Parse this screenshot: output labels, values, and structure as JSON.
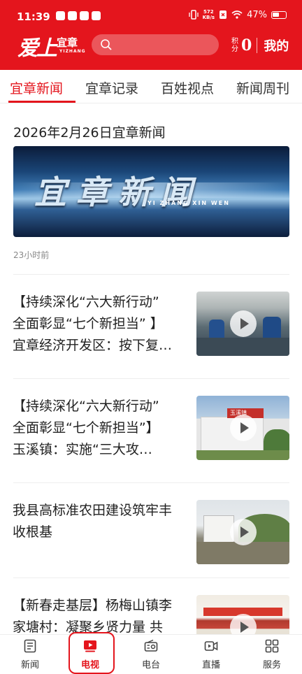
{
  "status_bar": {
    "time": "11:39",
    "net_speed_top": "572",
    "net_speed_bottom": "KB/s",
    "battery": "47%"
  },
  "header": {
    "logo_script": "爱上",
    "logo_name": "宜章",
    "logo_en": "YIZHANG",
    "search_placeholder": "",
    "points_label": "积分",
    "points_value": "0",
    "mine_label": "我的"
  },
  "tabs": [
    {
      "label": "宜章新闻",
      "active": true
    },
    {
      "label": "宜章记录",
      "active": false
    },
    {
      "label": "百姓视点",
      "active": false
    },
    {
      "label": "新闻周刊",
      "active": false
    }
  ],
  "featured": {
    "title": "2026年2月26日宜章新闻",
    "image_title": "宜章新闻",
    "image_subtitle": "YI ZHANG XIN WEN",
    "time": "23小时前"
  },
  "items": [
    {
      "line1": "【持续深化“六大新行动”",
      "line2": "全面彰显“七个新担当” 】",
      "line3": "宜章经济开发区：按下复…",
      "thumb": "factory-workers"
    },
    {
      "line1": "【持续深化“六大新行动”",
      "line2": " 全面彰显“七个新担当”】",
      "line3": "玉溪镇：实施“三大攻…",
      "thumb_sign": "玉溪镇",
      "thumb": "town-building"
    },
    {
      "line1": "我县高标准农田建设筑牢丰",
      "line2": "收根基",
      "line3": "",
      "thumb": "farmland-construction"
    },
    {
      "line1": "【新春走基层】杨梅山镇李",
      "line2": "家塘村：凝聚乡贤力量 共",
      "line3": "",
      "thumb": "meeting-hall"
    }
  ],
  "bottom_nav": [
    {
      "label": "新闻",
      "icon": "news-icon",
      "active": false
    },
    {
      "label": "电视",
      "icon": "tv-play-icon",
      "active": true
    },
    {
      "label": "电台",
      "icon": "radio-icon",
      "active": false
    },
    {
      "label": "直播",
      "icon": "live-video-icon",
      "active": false
    },
    {
      "label": "服务",
      "icon": "grid-services-icon",
      "active": false
    }
  ],
  "colors": {
    "brand_red": "#e4151d"
  }
}
